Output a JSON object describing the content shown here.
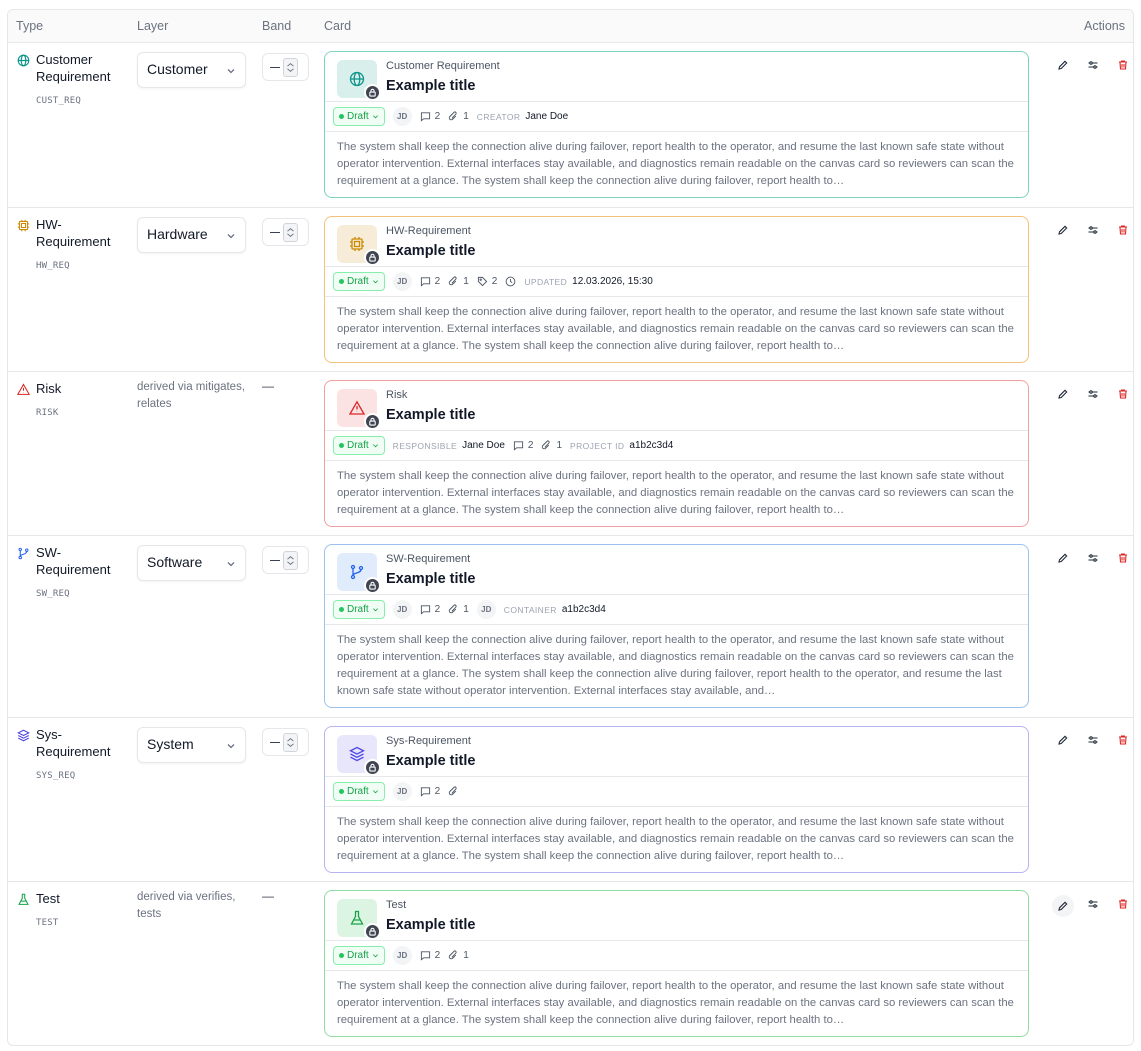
{
  "headers": {
    "type": "Type",
    "layer": "Layer",
    "band": "Band",
    "card": "Card",
    "actions": "Actions"
  },
  "rows": [
    {
      "type_name": "Customer Requirement",
      "type_code": "CUST_REQ",
      "icon": "globe-icon",
      "color": "#0d9488",
      "layer": "Customer",
      "card": {
        "type_label": "Customer Requirement",
        "title": "Example title",
        "status": "Draft",
        "avatar": "JD",
        "comments": "2",
        "attachments": "1",
        "meta_label": "CREATOR",
        "meta_value": "Jane Doe",
        "description": "The system shall keep the connection alive during failover, report health to the operator, and resume the last known safe state without operator intervention. External interfaces stay available, and diagnostics remain readable on the canvas card so reviewers can scan the requirement at a glance. The system shall keep the connection alive during failover, report health to…"
      }
    },
    {
      "type_name": "HW-Requirement",
      "type_code": "HW_REQ",
      "icon": "chip-icon",
      "color": "#ca8a04",
      "layer": "Hardware",
      "card": {
        "type_label": "HW-Requirement",
        "title": "Example title",
        "status": "Draft",
        "avatar": "JD",
        "comments": "2",
        "attachments": "1",
        "tags": "2",
        "meta_label": "UPDATED",
        "meta_value": "12.03.2026, 15:30",
        "description": "The system shall keep the connection alive during failover, report health to the operator, and resume the last known safe state without operator intervention. External interfaces stay available, and diagnostics remain readable on the canvas card so reviewers can scan the requirement at a glance. The system shall keep the connection alive during failover, report health to…"
      }
    },
    {
      "type_name": "Risk",
      "type_code": "RISK",
      "icon": "warning-icon",
      "color": "#dc2626",
      "derived": "derived via mitigates, relates",
      "band_dash": "—",
      "card": {
        "type_label": "Risk",
        "title": "Example title",
        "status": "Draft",
        "responsible_label": "RESPONSIBLE",
        "responsible_value": "Jane Doe",
        "comments": "2",
        "attachments": "1",
        "meta_label": "PROJECT ID",
        "meta_value": "a1b2c3d4",
        "description": "The system shall keep the connection alive during failover, report health to the operator, and resume the last known safe state without operator intervention. External interfaces stay available, and diagnostics remain readable on the canvas card so reviewers can scan the requirement at a glance. The system shall keep the connection alive during failover, report health to…"
      }
    },
    {
      "type_name": "SW-Requirement",
      "type_code": "SW_REQ",
      "icon": "branch-icon",
      "color": "#2563eb",
      "layer": "Software",
      "card": {
        "type_label": "SW-Requirement",
        "title": "Example title",
        "status": "Draft",
        "avatar": "JD",
        "comments": "2",
        "attachments": "1",
        "avatar2": "JD",
        "meta_label": "CONTAINER",
        "meta_value": "a1b2c3d4",
        "description": "The system shall keep the connection alive during failover, report health to the operator, and resume the last known safe state without operator intervention. External interfaces stay available, and diagnostics remain readable on the canvas card so reviewers can scan the requirement at a glance. The system shall keep the connection alive during failover, report health to the operator, and resume the last known safe state without operator intervention. External interfaces stay available, and…"
      }
    },
    {
      "type_name": "Sys-Requirement",
      "type_code": "SYS_REQ",
      "icon": "layers-icon",
      "color": "#4f46e5",
      "layer": "System",
      "card": {
        "type_label": "Sys-Requirement",
        "title": "Example title",
        "status": "Draft",
        "avatar": "JD",
        "comments": "2",
        "attachments": "",
        "description": "The system shall keep the connection alive during failover, report health to the operator, and resume the last known safe state without operator intervention. External interfaces stay available, and diagnostics remain readable on the canvas card so reviewers can scan the requirement at a glance. The system shall keep the connection alive during failover, report health to…"
      }
    },
    {
      "type_name": "Test",
      "type_code": "TEST",
      "icon": "flask-icon",
      "color": "#16a34a",
      "derived": "derived via verifies, tests",
      "band_dash": "—",
      "card": {
        "type_label": "Test",
        "title": "Example title",
        "status": "Draft",
        "avatar": "JD",
        "comments": "2",
        "attachments": "1",
        "description": "The system shall keep the connection alive during failover, report health to the operator, and resume the last known safe state without operator intervention. External interfaces stay available, and diagnostics remain readable on the canvas card so reviewers can scan the requirement at a glance. The system shall keep the connection alive during failover, report health to…"
      }
    }
  ],
  "colors": {
    "customer_border": "#7dd3c0",
    "customer_bg": "#d8efec",
    "hw_border": "#f2c27a",
    "hw_bg": "#f6ecd7",
    "risk_border": "#f0a0a0",
    "risk_bg": "#fbe3e3",
    "sw_border": "#9cc1ef",
    "sw_bg": "#e0ecfb",
    "sys_border": "#b7b4ef",
    "sys_bg": "#e7e6fb",
    "test_border": "#8fdca3",
    "test_bg": "#dcf5e3"
  },
  "action_icons": [
    "pencil-icon",
    "sliders-icon",
    "trash-icon"
  ]
}
